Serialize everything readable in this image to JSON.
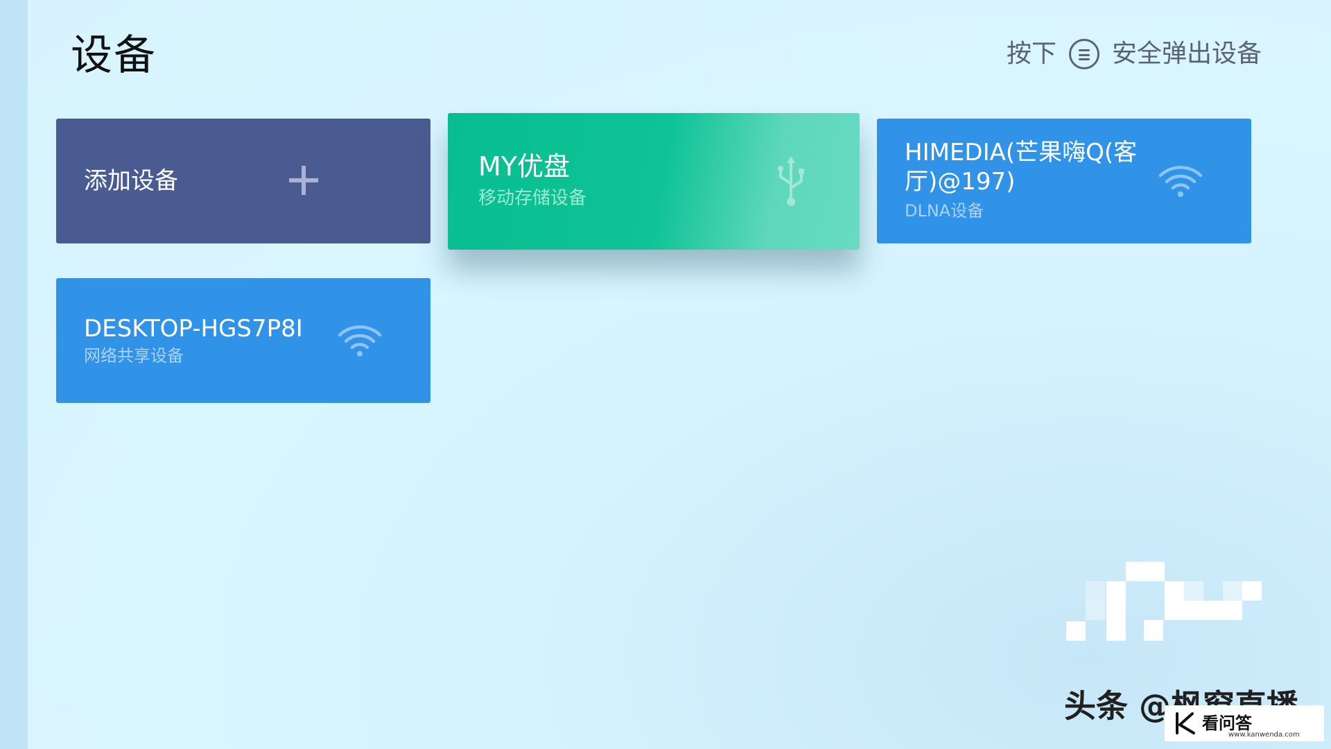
{
  "header": {
    "title": "设备",
    "hint_prefix": "按下",
    "hint_icon": "menu-icon",
    "hint_suffix": "安全弹出设备"
  },
  "cards": [
    {
      "name": "添加设备",
      "subtitle": "",
      "icon": "plus-icon",
      "color": "#4a5b92",
      "focused": false
    },
    {
      "name": "MY优盘",
      "subtitle": "移动存储设备",
      "icon": "usb-icon",
      "color": "#10c396",
      "focused": true
    },
    {
      "name": "HIMEDIA(芒果嗨Q(客厅)@197)",
      "subtitle": "DLNA设备",
      "icon": "wifi-icon",
      "color": "#3093e8",
      "focused": false
    },
    {
      "name": "DESKTOP-HGS7P8I",
      "subtitle": "网络共享设备",
      "icon": "wifi-icon",
      "color": "#3093e8",
      "focused": false
    }
  ],
  "watermark": {
    "text": "头条 @枫窗直播",
    "badge_text": "看问答",
    "badge_url": "www.kanwenda.com"
  }
}
